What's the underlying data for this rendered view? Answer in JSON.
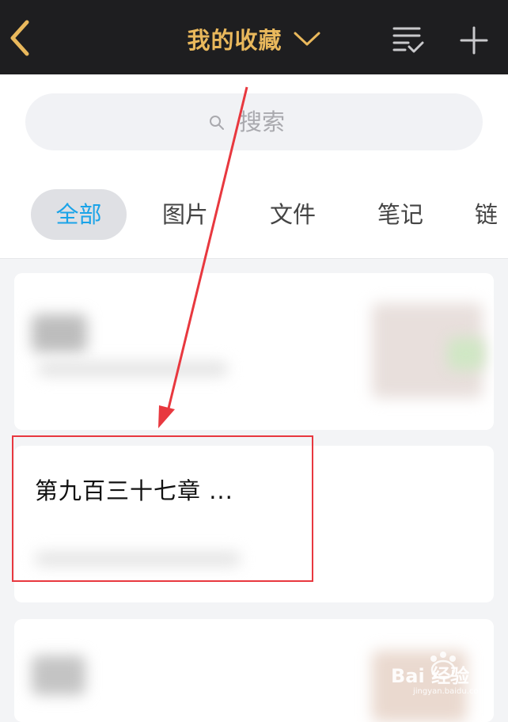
{
  "header": {
    "title": "我的收藏",
    "icons": [
      "back-icon",
      "chevron-down-icon",
      "list-check-icon",
      "plus-icon"
    ],
    "accent_color": "#e9b85c",
    "bg_color": "#1e1e20"
  },
  "search": {
    "placeholder": "搜索"
  },
  "tabs": [
    {
      "label": "全部",
      "active": true
    },
    {
      "label": "图片",
      "active": false
    },
    {
      "label": "文件",
      "active": false
    },
    {
      "label": "笔记",
      "active": false
    },
    {
      "label": "链",
      "active": false
    }
  ],
  "items": [
    {
      "title": ""
    },
    {
      "title": "第九百三十七章  ..."
    },
    {
      "title": ""
    }
  ],
  "annotation": {
    "highlight_color": "#e8383f"
  },
  "watermark": {
    "text": "Bai 经验",
    "sub": "jingyan.baidu.com"
  }
}
